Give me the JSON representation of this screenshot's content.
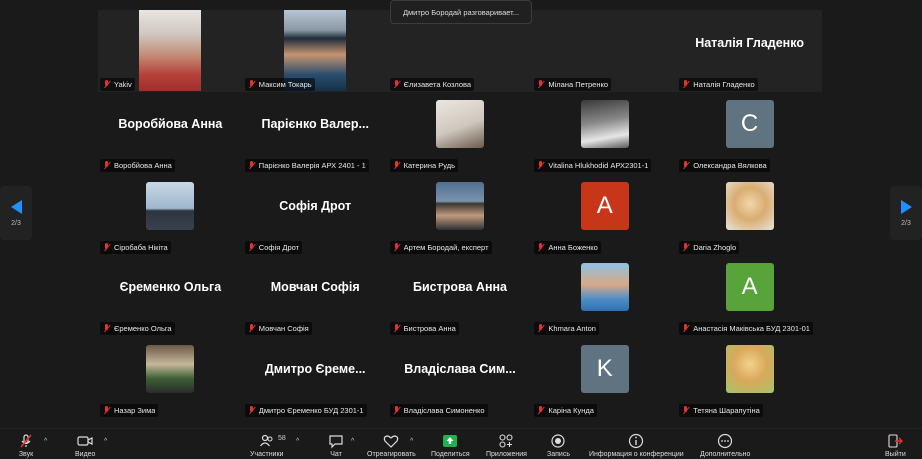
{
  "tooltip": "Дмитро Бородай разговаривает...",
  "pager": {
    "left": "2/3",
    "right": "2/3"
  },
  "participants_count": "58",
  "tiles": [
    {
      "label": "Yakiv",
      "video": "a"
    },
    {
      "label": "Максим Токарь",
      "video": "b"
    },
    {
      "label": "Єлизавета Козлова"
    },
    {
      "label": "Мілана Петренко"
    },
    {
      "label": "Наталія Гладенко",
      "big": "Наталія Гладенко"
    },
    {
      "label": "Воробйова Анна",
      "big": "Воробйова Анна"
    },
    {
      "label": "Парієнко Валерія АРХ 2401 - 1",
      "big": "Парієнко Валер..."
    },
    {
      "label": "Катерина Рудь",
      "photo": "p1"
    },
    {
      "label": "Vitalina Hlukhodid АРХ2301-1",
      "photo": "p2"
    },
    {
      "label": "Олександра Вялкова",
      "initial": "C",
      "color": "#5f7380"
    },
    {
      "label": "Сіробаба Нікіта",
      "photo": "p3"
    },
    {
      "label": "Софія Дрот",
      "big": "Софія Дрот"
    },
    {
      "label": "Артем Бородай, експерт",
      "photo": "p4"
    },
    {
      "label": "Анна Боженко",
      "initial": "A",
      "color": "#c8361a"
    },
    {
      "label": "Daria Zhoglo",
      "photo": "p5"
    },
    {
      "label": "Єременко Ольга",
      "big": "Єременко Ольга"
    },
    {
      "label": "Мовчан Софія",
      "big": "Мовчан Софія"
    },
    {
      "label": "Бистрова Анна",
      "big": "Бистрова Анна"
    },
    {
      "label": "Khmara Anton",
      "photo": "p6"
    },
    {
      "label": "Анастасія Маківська БУД 2301-01",
      "initial": "A",
      "color": "#58a43a"
    },
    {
      "label": "Назар Зима",
      "photo": "p7"
    },
    {
      "label": "Дмитро Єременко БУД 2301-1",
      "big": "Дмитро Єреме..."
    },
    {
      "label": "Владіслава Симоненко",
      "big": "Владіслава Сим..."
    },
    {
      "label": "Каріна Кунда",
      "initial": "K",
      "color": "#5f7380"
    },
    {
      "label": "Тетяна Шарапутіна",
      "photo": "p8"
    }
  ],
  "toolbar": {
    "sound": "Звук",
    "video": "Видео",
    "participants": "Участники",
    "chat": "Чат",
    "react": "Отреагировать",
    "share": "Поделиться",
    "apps": "Приложения",
    "record": "Запись",
    "info": "Информация о конференции",
    "more": "Дополнительно",
    "leave": "Выйти"
  }
}
